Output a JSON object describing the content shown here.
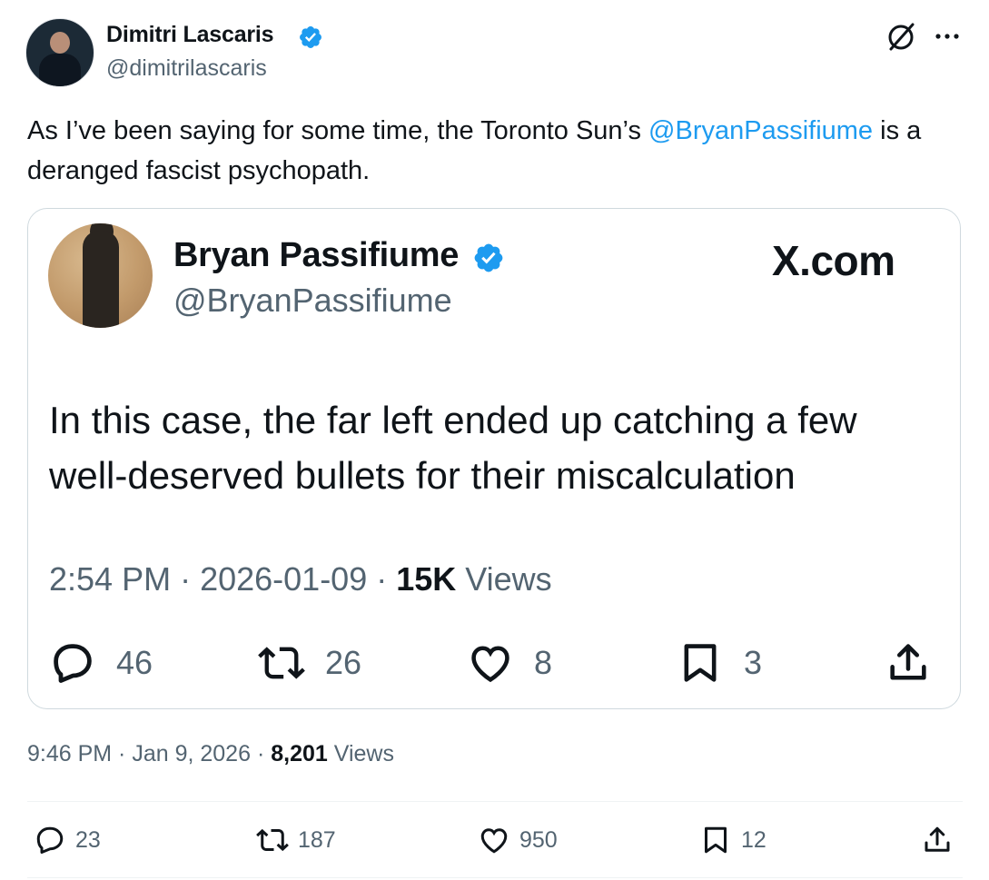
{
  "author": {
    "display_name": "Dimitri Lascaris",
    "handle": "@dimitrilascaris",
    "verified": true,
    "avatar_icon": "profile-photo"
  },
  "tweet": {
    "text_before": "As I’ve been saying for some time, the Toronto Sun’s ",
    "mention": "@BryanPassifiume",
    "text_after": " is a deranged fascist psychopath."
  },
  "quoted_card": {
    "display_name": "Bryan Passifiume",
    "handle": "@BryanPassifiume",
    "verified": true,
    "source_label": "X.com",
    "text": "In this case, the far left ended up catching a few well-deserved bullets for their miscalculation",
    "time": "2:54 PM",
    "sep1": " · ",
    "date": "2026-01-09",
    "sep2": " · ",
    "views_count": "15K",
    "views_label": " Views",
    "actions": {
      "replies": "46",
      "reposts": "26",
      "likes": "8",
      "bookmarks": "3"
    }
  },
  "meta": {
    "time": "9:46 PM",
    "sep1": " · ",
    "date": "Jan 9, 2026",
    "sep2": " · ",
    "views_count": "8,201",
    "views_label": " Views"
  },
  "actions": {
    "replies": "23",
    "reposts": "187",
    "likes": "950",
    "bookmarks": "12"
  },
  "colors": {
    "accent": "#1d9bf0",
    "text": "#0f1419",
    "secondary": "#536471",
    "border": "#cfd9de",
    "divider": "#eff3f4"
  }
}
